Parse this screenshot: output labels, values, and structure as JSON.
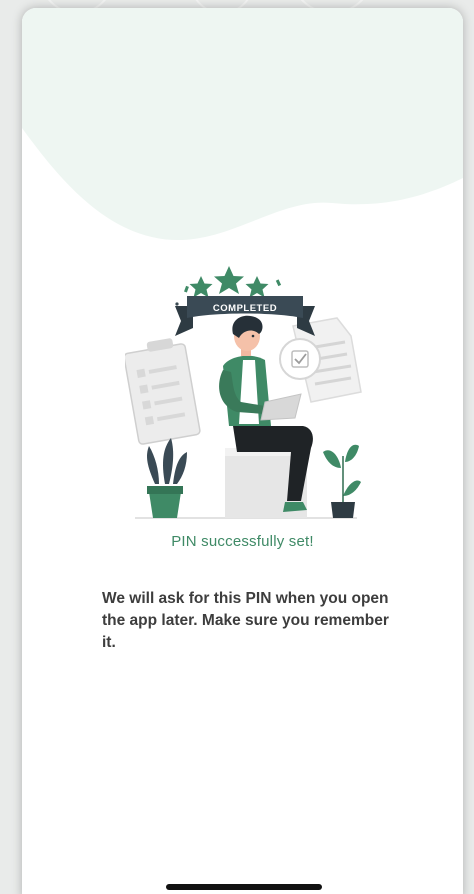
{
  "screen": {
    "success_message": "PIN successfully set!",
    "info_message": "We will ask for this PIN when you open the app later. Make sure you remember it."
  },
  "illustration": {
    "ribbon_label": "COMPLETED",
    "star_count": 3
  },
  "colors": {
    "accent_green": "#3f8a66",
    "wave_mint": "#eef6f2",
    "text_dark": "#3d3d3d"
  },
  "icons": {
    "stars": "star-icon",
    "check": "check-icon",
    "home_indicator": "home-indicator"
  }
}
